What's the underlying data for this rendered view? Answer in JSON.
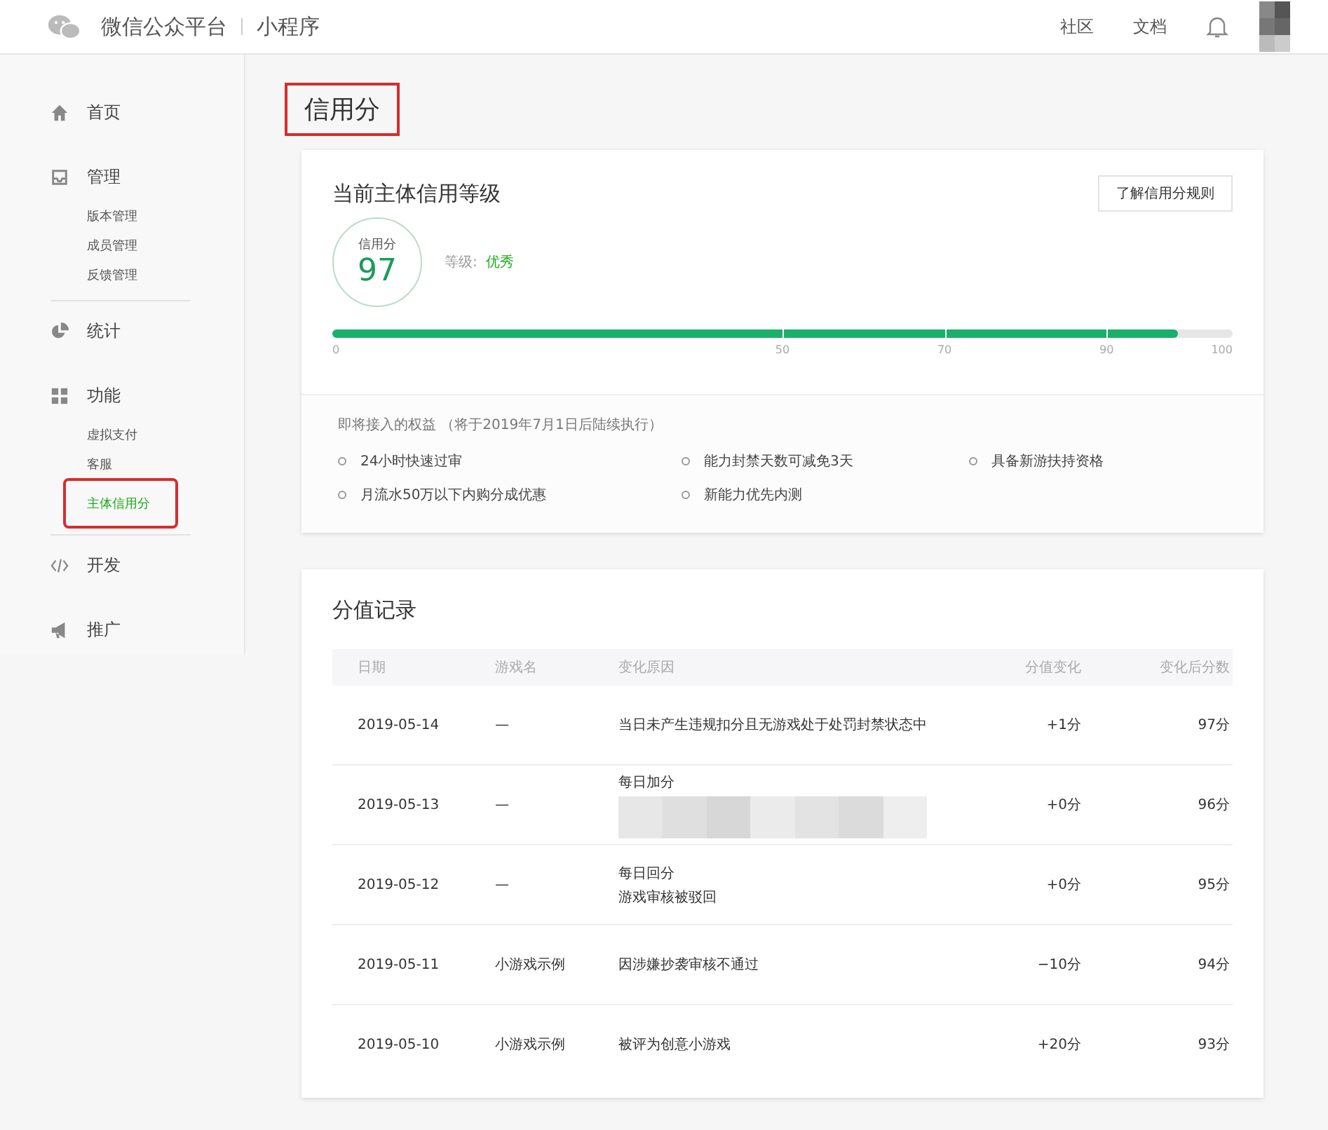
{
  "header": {
    "brand": "微信公众平台",
    "product": "小程序",
    "links": [
      "社区",
      "文档"
    ]
  },
  "sidebar": {
    "items": [
      {
        "label": "首页"
      },
      {
        "label": "管理",
        "children": [
          {
            "label": "版本管理",
            "selected": false,
            "highlighted": false
          },
          {
            "label": "成员管理",
            "selected": false,
            "highlighted": false
          },
          {
            "label": "反馈管理",
            "selected": false,
            "highlighted": false
          }
        ]
      },
      {
        "label": "统计"
      },
      {
        "label": "功能",
        "children": [
          {
            "label": "虚拟支付",
            "selected": false,
            "highlighted": false
          },
          {
            "label": "客服",
            "selected": false,
            "highlighted": false
          },
          {
            "label": "主体信用分",
            "selected": true,
            "highlighted": true
          }
        ]
      },
      {
        "label": "开发"
      },
      {
        "label": "推广"
      }
    ]
  },
  "page": {
    "title": "信用分",
    "highlighted": true
  },
  "credit": {
    "title": "当前主体信用等级",
    "rules_button": "了解信用分规则",
    "score_label": "信用分",
    "score": "97",
    "grade_label": "等级:",
    "grade": "优秀",
    "level": 0.94,
    "ticks": [
      "0",
      "50",
      "70",
      "90",
      "100"
    ],
    "benefits_title": "即将接入的权益 （将于2019年7月1日后陆续执行）",
    "benefits": [
      "24小时快速过审",
      "能力封禁天数可减免3天",
      "具备新游扶持资格",
      "月流水50万以下内购分成优惠",
      "新能力优先内测"
    ]
  },
  "records": {
    "title": "分值记录",
    "columns": [
      "日期",
      "游戏名",
      "变化原因",
      "分值变化",
      "变化后分数"
    ],
    "rows": [
      {
        "date": "2019-05-14",
        "game": "—",
        "reasons": [
          "当日未产生违规扣分且无游戏处于处罚封禁状态中"
        ],
        "redacted": false,
        "change": "+1分",
        "total": "97分"
      },
      {
        "date": "2019-05-13",
        "game": "—",
        "reasons": [
          "每日加分"
        ],
        "redacted": true,
        "change": "+0分",
        "total": "96分"
      },
      {
        "date": "2019-05-12",
        "game": "—",
        "reasons": [
          "每日回分",
          "游戏审核被驳回"
        ],
        "redacted": false,
        "change": "+0分",
        "total": "95分"
      },
      {
        "date": "2019-05-11",
        "game": "小游戏示例",
        "reasons": [
          "因涉嫌抄袭审核不通过"
        ],
        "redacted": false,
        "change": "−10分",
        "total": "94分"
      },
      {
        "date": "2019-05-10",
        "game": "小游戏示例",
        "reasons": [
          "被评为创意小游戏"
        ],
        "redacted": false,
        "change": "+20分",
        "total": "93分"
      }
    ]
  }
}
